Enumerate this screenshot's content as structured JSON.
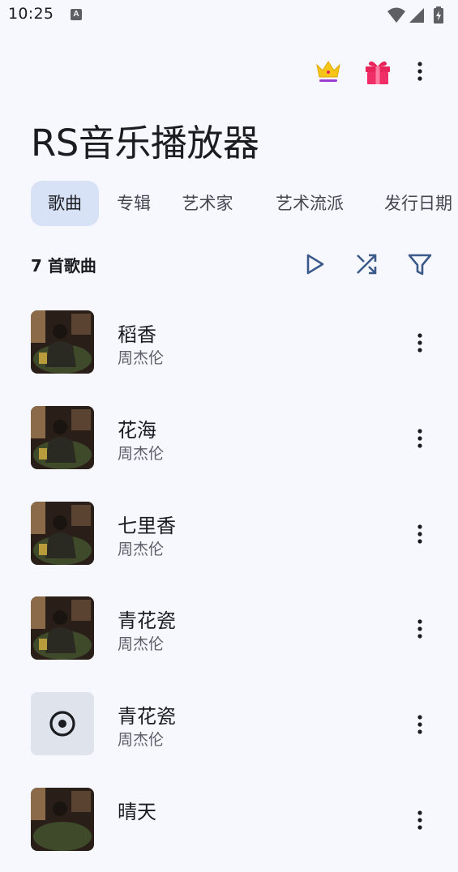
{
  "status_bar": {
    "time": "10:25",
    "notification_badge": "A"
  },
  "header": {
    "title": "RS音乐播放器",
    "icons": [
      "crown-icon",
      "gift-icon",
      "more-vert-icon"
    ]
  },
  "tabs": [
    {
      "label": "歌曲",
      "active": true
    },
    {
      "label": "专辑",
      "active": false
    },
    {
      "label": "艺术家",
      "active": false
    },
    {
      "label": "艺术流派",
      "active": false
    },
    {
      "label": "发行日期",
      "active": false
    }
  ],
  "list_header": {
    "count_label": "7 首歌曲",
    "actions": [
      "play-icon",
      "shuffle-icon",
      "filter-icon"
    ]
  },
  "songs": [
    {
      "title": "稻香",
      "artist": "周杰伦",
      "cover": "album-art"
    },
    {
      "title": "花海",
      "artist": "周杰伦",
      "cover": "album-art"
    },
    {
      "title": "七里香",
      "artist": "周杰伦",
      "cover": "album-art"
    },
    {
      "title": "青花瓷",
      "artist": "周杰伦",
      "cover": "album-art"
    },
    {
      "title": "青花瓷",
      "artist": "周杰伦",
      "cover": "disc-icon"
    },
    {
      "title": "晴天",
      "artist": "周杰伦",
      "cover": "album-art"
    }
  ],
  "colors": {
    "background": "#f7f8fe",
    "active_tab": "#d7e2f7",
    "accent_icon": "#3b5a8a",
    "crown": "#f5c518",
    "gift": "#e8245a"
  }
}
